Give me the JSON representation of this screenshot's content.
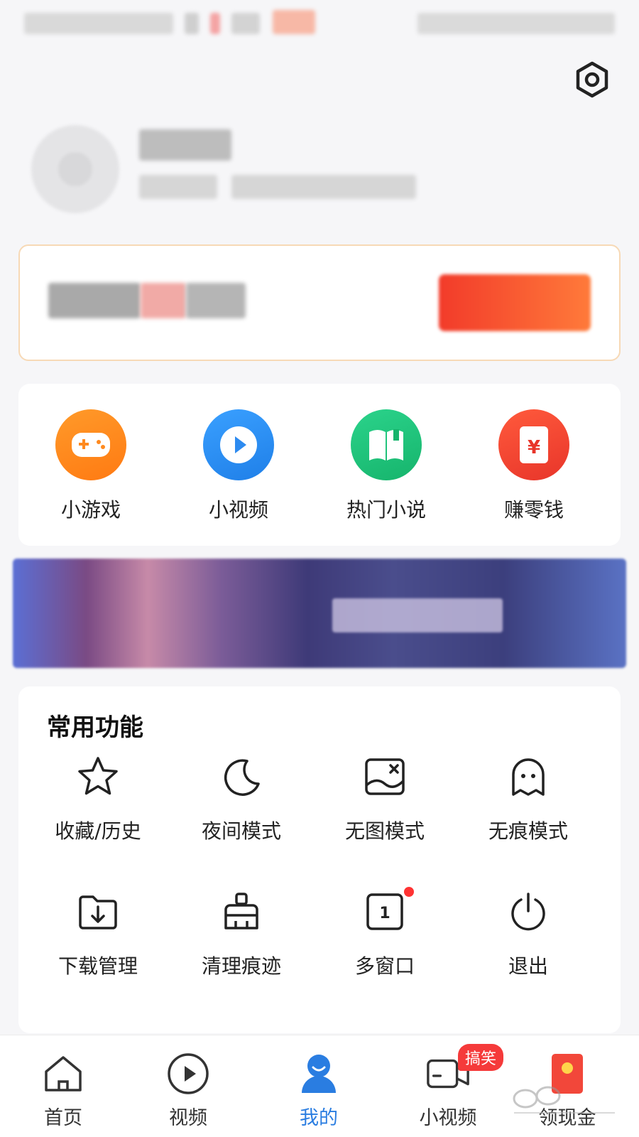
{
  "quick_actions": [
    {
      "label": "小游戏",
      "icon": "gamepad-icon",
      "color": "#ff8a1f"
    },
    {
      "label": "小视频",
      "icon": "play-circle-icon",
      "color": "#2d8bf0"
    },
    {
      "label": "热门小说",
      "icon": "book-icon",
      "color": "#22c07a"
    },
    {
      "label": "赚零钱",
      "icon": "red-envelope-icon",
      "color": "#f2473a"
    }
  ],
  "common_functions": {
    "title": "常用功能",
    "items": [
      {
        "label": "收藏/历史",
        "icon": "star-icon"
      },
      {
        "label": "夜间模式",
        "icon": "moon-icon"
      },
      {
        "label": "无图模式",
        "icon": "no-image-icon"
      },
      {
        "label": "无痕模式",
        "icon": "ghost-icon"
      },
      {
        "label": "下载管理",
        "icon": "download-folder-icon"
      },
      {
        "label": "清理痕迹",
        "icon": "brush-icon"
      },
      {
        "label": "多窗口",
        "icon": "window-count-icon",
        "window_count": "1",
        "has_dot": true
      },
      {
        "label": "退出",
        "icon": "power-icon"
      }
    ]
  },
  "tabbar": {
    "items": [
      {
        "label": "首页",
        "icon": "home-icon",
        "active": false
      },
      {
        "label": "视频",
        "icon": "video-play-icon",
        "active": false
      },
      {
        "label": "我的",
        "icon": "user-icon",
        "active": true
      },
      {
        "label": "小视频",
        "icon": "camera-icon",
        "active": false,
        "badge": "搞笑"
      },
      {
        "label": "领现金",
        "icon": "cash-envelope-icon",
        "active": false
      }
    ]
  },
  "colors": {
    "accent": "#2a7de1",
    "promo_button": "#f23b2a",
    "badge": "#f53a3a"
  }
}
